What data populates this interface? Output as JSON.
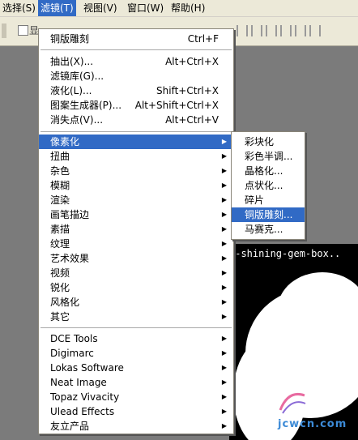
{
  "menubar": {
    "items": [
      {
        "label": "选择(S)"
      },
      {
        "label": "滤镜(T)"
      },
      {
        "label": "视图(V)"
      },
      {
        "label": "窗口(W)"
      },
      {
        "label": "帮助(H)"
      }
    ]
  },
  "toolbar": {
    "checkbox_label": "显"
  },
  "document": {
    "title": "y-shining-gem-box..",
    "watermark": "jcwcn.com"
  },
  "filter_menu": {
    "last_filter": {
      "label": "铜版雕刻",
      "shortcut": "Ctrl+F"
    },
    "group1": [
      {
        "label": "抽出(X)...",
        "shortcut": "Alt+Ctrl+X"
      },
      {
        "label": "滤镜库(G)...",
        "shortcut": ""
      },
      {
        "label": "液化(L)...",
        "shortcut": "Shift+Ctrl+X"
      },
      {
        "label": "图案生成器(P)...",
        "shortcut": "Alt+Shift+Ctrl+X"
      },
      {
        "label": "消失点(V)...",
        "shortcut": "Alt+Ctrl+V"
      }
    ],
    "group2": [
      {
        "label": "像素化"
      },
      {
        "label": "扭曲"
      },
      {
        "label": "杂色"
      },
      {
        "label": "模糊"
      },
      {
        "label": "渲染"
      },
      {
        "label": "画笔描边"
      },
      {
        "label": "素描"
      },
      {
        "label": "纹理"
      },
      {
        "label": "艺术效果"
      },
      {
        "label": "视频"
      },
      {
        "label": "锐化"
      },
      {
        "label": "风格化"
      },
      {
        "label": "其它"
      }
    ],
    "group3": [
      {
        "label": "DCE Tools"
      },
      {
        "label": "Digimarc"
      },
      {
        "label": "Lokas Software"
      },
      {
        "label": "Neat Image"
      },
      {
        "label": "Topaz Vivacity"
      },
      {
        "label": "Ulead Effects"
      },
      {
        "label": "友立产品"
      }
    ]
  },
  "pixelate_submenu": {
    "items": [
      {
        "label": "彩块化"
      },
      {
        "label": "彩色半调..."
      },
      {
        "label": "晶格化..."
      },
      {
        "label": "点状化..."
      },
      {
        "label": "碎片"
      },
      {
        "label": "铜版雕刻..."
      },
      {
        "label": "马赛克..."
      }
    ]
  },
  "colors": {
    "highlight": "#316ac5",
    "menubar": "#ece9d8",
    "workspace": "#7b7b7b"
  }
}
